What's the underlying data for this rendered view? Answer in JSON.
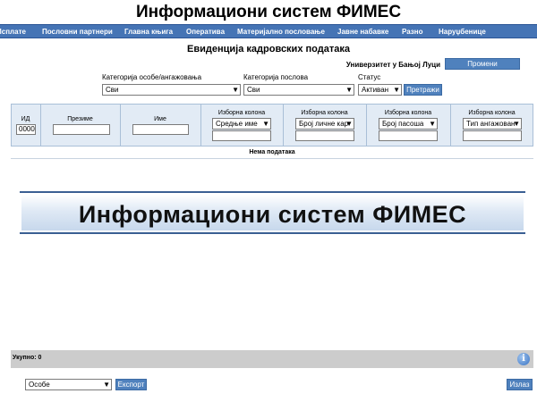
{
  "app": {
    "title": "Информациони систем ФИМЕС"
  },
  "menu": [
    {
      "label": "Исплате"
    },
    {
      "label": "Пословни партнери"
    },
    {
      "label": "Главна књига"
    },
    {
      "label": "Оперативa"
    },
    {
      "label": "Материјално пословање"
    },
    {
      "label": "Јавне набавке"
    },
    {
      "label": "Разно"
    },
    {
      "label": "Наруџбенице"
    }
  ],
  "page": {
    "title": "Евиденција кадровских података"
  },
  "organization": {
    "name": "Универзитет у Бањој Луци",
    "change_label": "Промени"
  },
  "filters": {
    "person_category": {
      "label": "Категорија особе/ангажовања",
      "value": "Сви"
    },
    "job_category": {
      "label": "Категорија послова",
      "value": "Сви"
    },
    "status": {
      "label": "Статус",
      "value": "Активан"
    },
    "search_label": "Претражи"
  },
  "columns": {
    "id": {
      "label": "ИД",
      "value": "0000"
    },
    "surname": {
      "label": "Презиме",
      "value": ""
    },
    "name": {
      "label": "Име",
      "value": ""
    },
    "custom1": {
      "label": "Изборна колона",
      "value": "Средње име"
    },
    "custom2": {
      "label": "Изборна колона",
      "value": "Број личне кар"
    },
    "custom3": {
      "label": "Изборна колона",
      "value": "Број пасоша"
    },
    "custom4": {
      "label": "Изборна колона",
      "value": "Тип ангажован"
    }
  },
  "table": {
    "empty_text": "Нема података"
  },
  "banner": {
    "text": "Информациони систем ФИМЕС"
  },
  "footer": {
    "total_label": "Укупно: 0",
    "export_type": "Особе",
    "export_label": "Експорт",
    "exit_label": "Излаз"
  },
  "colors": {
    "menu_bg": "#4574b5",
    "button_bg": "#4f81bd",
    "header_bg": "#e2ebf5"
  }
}
